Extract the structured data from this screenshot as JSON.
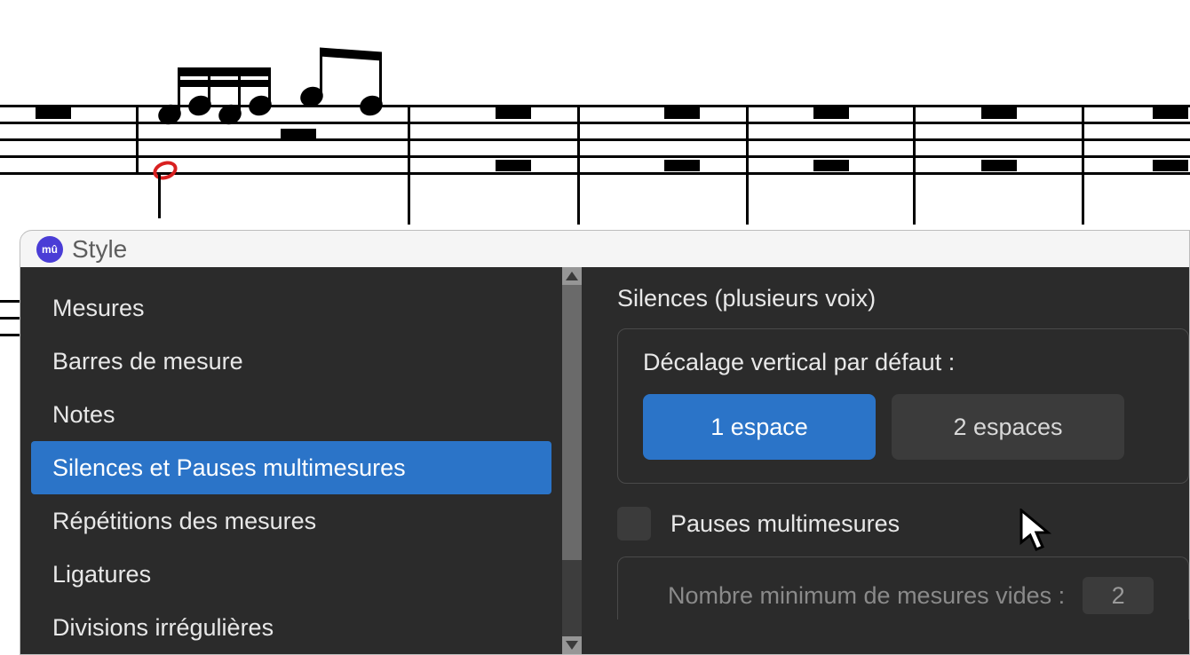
{
  "dialog": {
    "title": "Style",
    "sidebar": {
      "items": [
        {
          "label": "Mesures",
          "selected": false
        },
        {
          "label": "Barres de mesure",
          "selected": false
        },
        {
          "label": "Notes",
          "selected": false
        },
        {
          "label": "Silences et Pauses multimesures",
          "selected": true
        },
        {
          "label": "Répétitions des mesures",
          "selected": false
        },
        {
          "label": "Ligatures",
          "selected": false
        },
        {
          "label": "Divisions irrégulières",
          "selected": false
        }
      ]
    },
    "content": {
      "section1_title": "Silences (plusieurs voix)",
      "offset_label": "Décalage vertical par défaut :",
      "option1": "1 espace",
      "option2": "2 espaces",
      "section2_title": "Pauses multimesures",
      "min_label": "Nombre minimum de mesures vides :",
      "min_value": "2"
    }
  }
}
